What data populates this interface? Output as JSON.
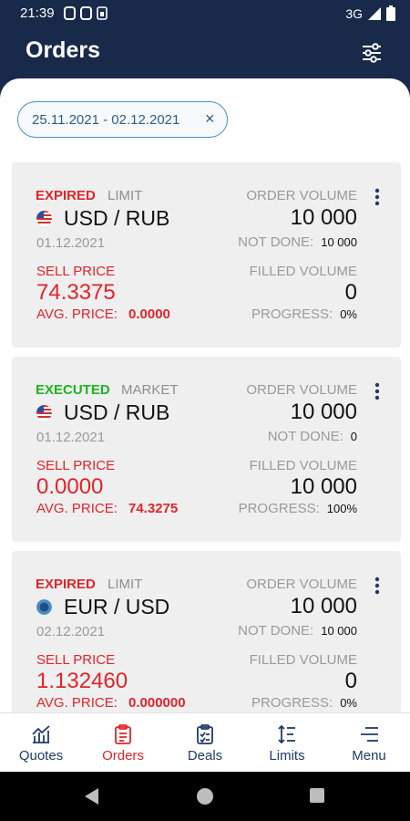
{
  "status_bar": {
    "time": "21:39",
    "network": "3G"
  },
  "header": {
    "title": "Orders"
  },
  "filter": {
    "date_range": "25.11.2021 - 02.12.2021",
    "clear": "×"
  },
  "labels": {
    "order_volume": "ORDER VOLUME",
    "not_done": "NOT DONE:",
    "sell_price": "SELL PRICE",
    "filled_volume": "FILLED VOLUME",
    "avg_price": "AVG. PRICE:",
    "progress": "PROGRESS:"
  },
  "orders": [
    {
      "status": "EXPIRED",
      "type": "LIMIT",
      "pair": "USD / RUB",
      "date": "01.12.2021",
      "sell_price": "74.3375",
      "avg_price": "0.0000",
      "order_volume": "10 000",
      "not_done": "10 000",
      "filled_volume": "0",
      "progress": "0%"
    },
    {
      "status": "EXECUTED",
      "type": "MARKET",
      "pair": "USD / RUB",
      "date": "01.12.2021",
      "sell_price": "0.0000",
      "avg_price": "74.3275",
      "order_volume": "10 000",
      "not_done": "0",
      "filled_volume": "10 000",
      "progress": "100%"
    },
    {
      "status": "EXPIRED",
      "type": "LIMIT",
      "pair": "EUR / USD",
      "date": "02.12.2021",
      "sell_price": "1.132460",
      "avg_price": "0.000000",
      "order_volume": "10 000",
      "not_done": "10 000",
      "filled_volume": "0",
      "progress": "0%"
    }
  ],
  "nav": [
    {
      "label": "Quotes",
      "icon": "chart-icon"
    },
    {
      "label": "Orders",
      "icon": "clipboard-icon",
      "active": true
    },
    {
      "label": "Deals",
      "icon": "checklist-icon"
    },
    {
      "label": "Limits",
      "icon": "sort-arrows-icon"
    },
    {
      "label": "Menu",
      "icon": "menu-icon"
    }
  ],
  "colors": {
    "header_bg": "#18294a",
    "sell": "#e1242a",
    "executed": "#1db41f",
    "expired": "#e1242a",
    "nav_text": "#1f3a68"
  }
}
